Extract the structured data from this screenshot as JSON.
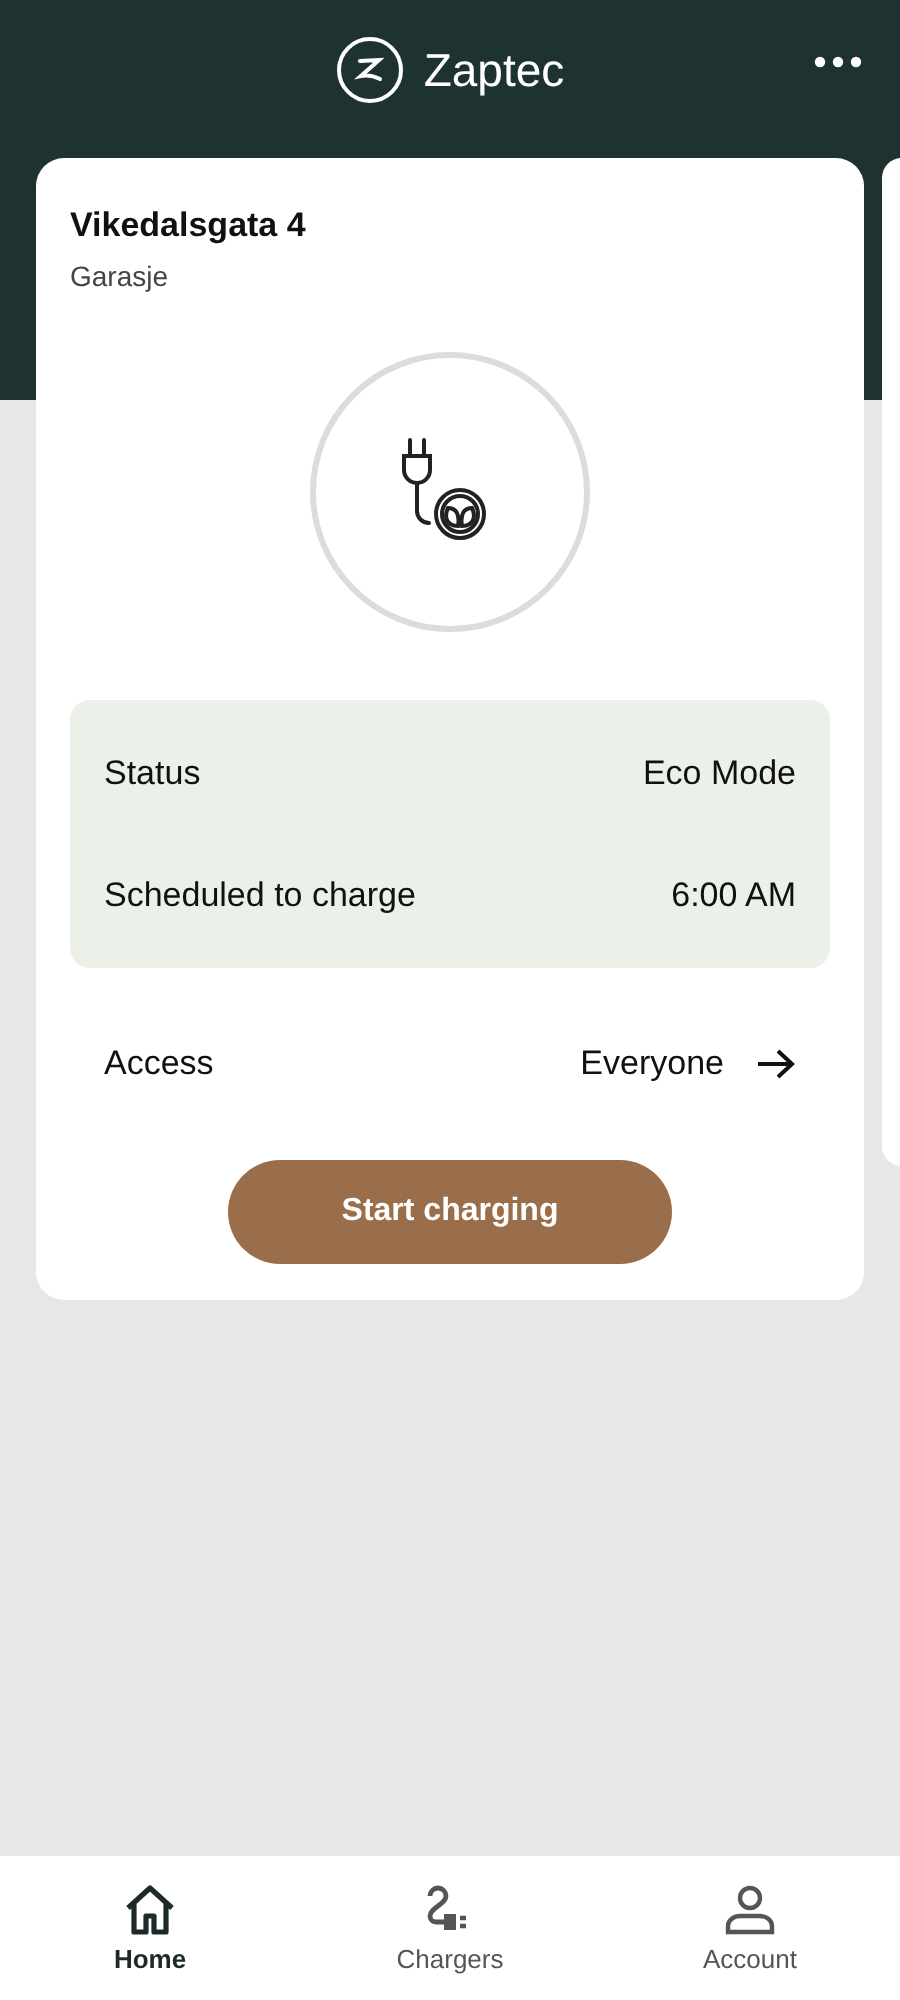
{
  "app_bar": {
    "title": "Zaptec"
  },
  "charger": {
    "name": "Vikedalsgata 4",
    "location": "Garasje",
    "status_rows": [
      {
        "label": "Status",
        "value": "Eco Mode"
      },
      {
        "label": "Scheduled to charge",
        "value": "6:00 AM"
      }
    ],
    "access": {
      "label": "Access",
      "value": "Everyone"
    },
    "action": "Start charging"
  },
  "tabs": [
    {
      "label": "Home",
      "kind": "home",
      "selected": true
    },
    {
      "label": "Chargers",
      "kind": "chargers",
      "selected": false
    },
    {
      "label": "Account",
      "kind": "account",
      "selected": false
    }
  ]
}
